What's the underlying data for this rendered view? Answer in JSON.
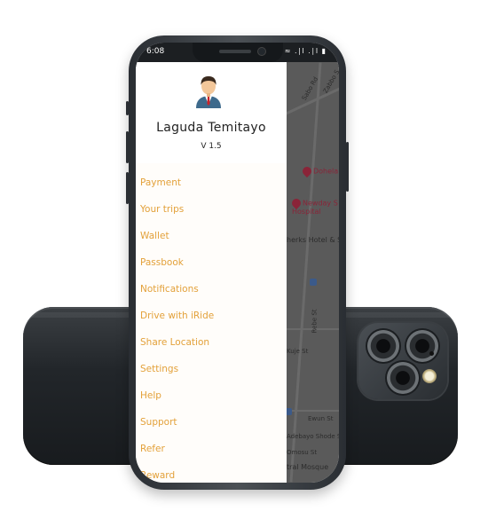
{
  "status": {
    "time": "6:08",
    "icons": "● ≈ .∣l .∣l ▮"
  },
  "user": {
    "name": "Laguda Temitayo",
    "version": "V 1.5"
  },
  "menu": [
    {
      "label": "Payment"
    },
    {
      "label": "Your trips"
    },
    {
      "label": "Wallet"
    },
    {
      "label": "Passbook"
    },
    {
      "label": "Notifications"
    },
    {
      "label": "Drive with iRide"
    },
    {
      "label": "Share Location"
    },
    {
      "label": "Settings"
    },
    {
      "label": "Help"
    },
    {
      "label": "Support"
    },
    {
      "label": "Refer"
    },
    {
      "label": "Reward"
    }
  ],
  "map": {
    "streets": [
      "Sabo Rd",
      "Zabbo S",
      "Kuje St",
      "Ewun St",
      "Adebayo Shode St",
      "Omosu St"
    ],
    "places": [
      "Dohela",
      "Newday S Hospital",
      "herks Hotel & S",
      "tral Mosque",
      "Rebe St"
    ]
  },
  "colors": {
    "accent": "#e3a13a",
    "map_bg": "#5a5a5a",
    "poi": "#8a2438"
  }
}
